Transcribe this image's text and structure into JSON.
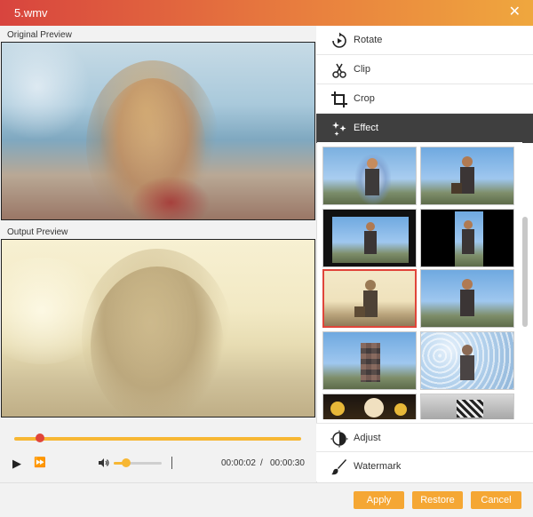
{
  "window": {
    "title": "5.wmv",
    "close_symbol": "✕"
  },
  "preview": {
    "original_label": "Original Preview",
    "output_label": "Output Preview"
  },
  "player": {
    "progress_fraction": 0.07,
    "volume_fraction": 0.2,
    "current_time": "00:00:02",
    "separator": "/",
    "total_time": "00:00:30"
  },
  "menu": {
    "items": [
      {
        "label": "Rotate",
        "icon": "rotate-icon",
        "active": false
      },
      {
        "label": "Clip",
        "icon": "scissors-icon",
        "active": false
      },
      {
        "label": "Crop",
        "icon": "crop-icon",
        "active": false
      },
      {
        "label": "Effect",
        "icon": "sparkle-icon",
        "active": true
      }
    ],
    "bottom_items": [
      {
        "label": "Adjust",
        "icon": "contrast-icon"
      },
      {
        "label": "Watermark",
        "icon": "brush-icon"
      }
    ]
  },
  "effects": {
    "thumbnails": [
      {
        "name": "effect-thumb-1",
        "selected": false
      },
      {
        "name": "effect-thumb-2",
        "selected": false
      },
      {
        "name": "effect-thumb-3",
        "selected": false
      },
      {
        "name": "effect-thumb-4",
        "selected": false
      },
      {
        "name": "effect-thumb-5",
        "selected": true
      },
      {
        "name": "effect-thumb-6",
        "selected": false
      },
      {
        "name": "effect-thumb-7",
        "selected": false
      },
      {
        "name": "effect-thumb-8",
        "selected": false
      },
      {
        "name": "effect-thumb-9",
        "selected": false
      },
      {
        "name": "effect-thumb-10",
        "selected": false
      }
    ]
  },
  "actions": {
    "apply": "Apply",
    "restore": "Restore",
    "cancel": "Cancel"
  },
  "colors": {
    "accent": "#f5a734",
    "selection": "#e0453a",
    "active_menu": "#3f3f3f"
  }
}
